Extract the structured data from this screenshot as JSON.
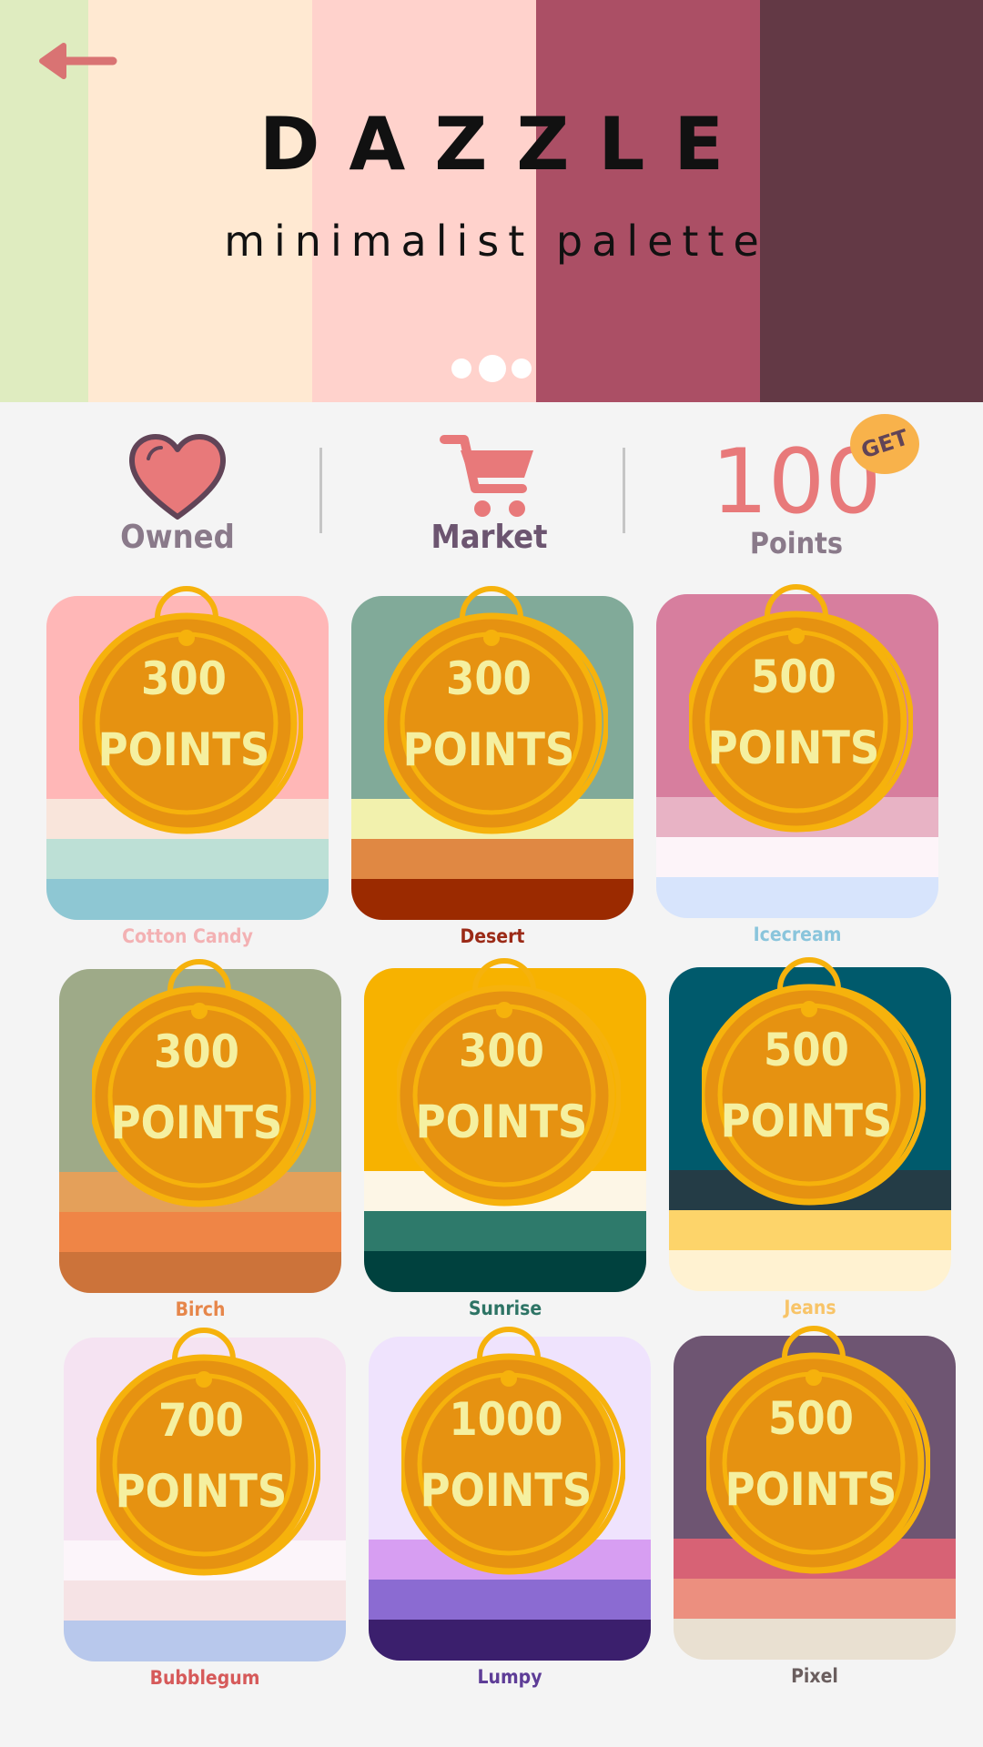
{
  "header": {
    "title": "DAZZLE",
    "subtitle": "minimalist palette",
    "stripes": [
      "#dfecc0",
      "#ffe9d2",
      "#ffd2cc",
      "#ab4f65",
      "#633945"
    ],
    "back_icon": "back-arrow-icon",
    "pager_dots": 3
  },
  "nav": {
    "owned": {
      "label": "Owned",
      "icon": "heart-icon"
    },
    "market": {
      "label": "Market",
      "icon": "cart-icon"
    },
    "points": {
      "value": "100",
      "label": "Points",
      "get_label": "GET"
    }
  },
  "colors": {
    "accent": "#e8797a",
    "nav_text": "#8a7a8a",
    "nav_active": "#6c5570",
    "coin": "#e69211",
    "coin_ring": "#f6b20c",
    "coin_text": "#f5f0a0"
  },
  "palettes": [
    {
      "name": "Cotton Candy",
      "name_color": "#f3b1b3",
      "points": "300",
      "unit": "POINTS",
      "colors": [
        "#ffb7b7",
        "#f9e5db",
        "#bde0d6",
        "#8ec7d3"
      ]
    },
    {
      "name": "Desert",
      "name_color": "#9b2a17",
      "points": "300",
      "unit": "POINTS",
      "colors": [
        "#81aa99",
        "#f2f1ad",
        "#e08843",
        "#9b2a00"
      ]
    },
    {
      "name": "Icecream",
      "name_color": "#8ac5dc",
      "points": "500",
      "unit": "POINTS",
      "colors": [
        "#d77e9e",
        "#e8b3c5",
        "#fdf4f9",
        "#d7e4fc"
      ]
    },
    {
      "name": "Birch",
      "name_color": "#e6864a",
      "points": "300",
      "unit": "POINTS",
      "colors": [
        "#9eaa88",
        "#e4a05a",
        "#ef8546",
        "#cc733a"
      ]
    },
    {
      "name": "Sunrise",
      "name_color": "#2d7465",
      "points": "300",
      "unit": "POINTS",
      "colors": [
        "#f7b200",
        "#fdf6e6",
        "#2e7a6b",
        "#00413e"
      ]
    },
    {
      "name": "Jeans",
      "name_color": "#f8c468",
      "points": "500",
      "unit": "POINTS",
      "colors": [
        "#005a6c",
        "#243c46",
        "#fdd46a",
        "#fff2d1"
      ]
    },
    {
      "name": "Bubblegum",
      "name_color": "#d65a5a",
      "points": "700",
      "unit": "POINTS",
      "colors": [
        "#f5e3f2",
        "#fcf5fa",
        "#f6e3e5",
        "#b8c8ec"
      ]
    },
    {
      "name": "Lumpy",
      "name_color": "#5e3d97",
      "points": "1000",
      "unit": "POINTS",
      "colors": [
        "#efe3fd",
        "#d79ef2",
        "#8b6bd2",
        "#3b1f6d"
      ]
    },
    {
      "name": "Pixel",
      "name_color": "#6a5e5e",
      "points": "500",
      "unit": "POINTS",
      "colors": [
        "#6e5572",
        "#d76275",
        "#ec8f7f",
        "#e9e0d1"
      ]
    }
  ]
}
